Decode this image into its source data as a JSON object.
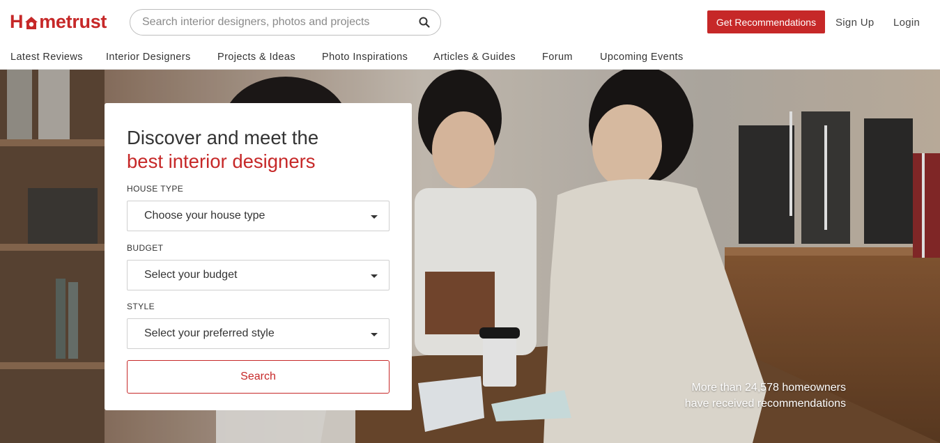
{
  "header": {
    "logo_text_pre": "H",
    "logo_text_post": "metrust",
    "search_placeholder": "Search interior designers, photos and projects",
    "cta_label": "Get Recommendations",
    "signup_label": "Sign Up",
    "login_label": "Login"
  },
  "nav": {
    "items": [
      {
        "label": "Latest Reviews"
      },
      {
        "label": "Interior Designers"
      },
      {
        "label": "Projects & Ideas"
      },
      {
        "label": "Photo Inspirations"
      },
      {
        "label": "Articles & Guides"
      },
      {
        "label": "Forum"
      },
      {
        "label": "Upcoming Events"
      }
    ]
  },
  "hero": {
    "heading_line1": "Discover and meet the",
    "heading_line2": "best interior designers",
    "house_type_label": "HOUSE TYPE",
    "house_type_value": "Choose your house type",
    "budget_label": "BUDGET",
    "budget_value": "Select your budget",
    "style_label": "STYLE",
    "style_value": "Select your preferred style",
    "search_button": "Search",
    "stat_line1": "More than 24,578 homeowners",
    "stat_line2": "have received recommendations"
  },
  "colors": {
    "brand": "#c62828",
    "text": "#333333"
  }
}
